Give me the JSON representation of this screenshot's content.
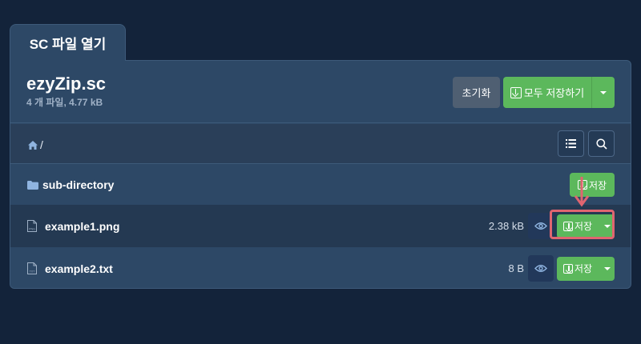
{
  "tab": {
    "label": "SC 파일 열기"
  },
  "archive": {
    "name": "ezyZip.sc",
    "summary": "4 개 파일, 4.77 kB"
  },
  "buttons": {
    "reset": "초기화",
    "save_all": "모두 저장하기"
  },
  "toolbar": {
    "path": "/",
    "home_icon": "home-icon",
    "list_icon": "list-icon",
    "search_icon": "search-icon"
  },
  "rows": [
    {
      "type": "directory",
      "name": "sub-directory",
      "save_label": "저장",
      "icon": "folder-icon"
    },
    {
      "type": "file",
      "name": "example1.png",
      "size": "2.38 kB",
      "save_label": "저장",
      "icon": "png-file-icon",
      "highlighted": true
    },
    {
      "type": "file",
      "name": "example2.txt",
      "size": "8 B",
      "save_label": "저장",
      "icon": "txt-file-icon"
    }
  ],
  "colors": {
    "background": "#13233a",
    "panel": "#2d4866",
    "accent_green": "#5cb85c",
    "highlight_red": "#e06570"
  }
}
